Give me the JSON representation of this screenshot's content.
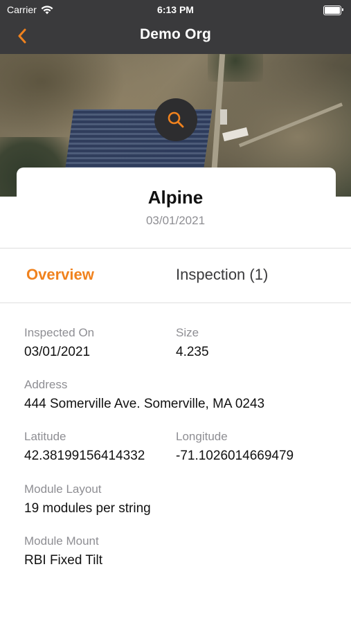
{
  "status_bar": {
    "carrier": "Carrier",
    "time": "6:13 PM"
  },
  "nav": {
    "title": "Demo Org",
    "accent": "#f0821e",
    "bar_color": "#3a3a3c"
  },
  "site": {
    "name": "Alpine",
    "date": "03/01/2021"
  },
  "tabs": [
    {
      "label": "Overview",
      "active": true
    },
    {
      "label": "Inspection (1)",
      "active": false
    }
  ],
  "details": {
    "inspected_on": {
      "label": "Inspected On",
      "value": "03/01/2021"
    },
    "size": {
      "label": "Size",
      "value": "4.235"
    },
    "address": {
      "label": "Address",
      "value": "444 Somerville Ave. Somerville, MA 0243"
    },
    "latitude": {
      "label": "Latitude",
      "value": "42.38199156414332"
    },
    "longitude": {
      "label": "Longitude",
      "value": "-71.1026014669479"
    },
    "module_layout": {
      "label": "Module Layout",
      "value": "19 modules per string"
    },
    "module_mount": {
      "label": "Module Mount",
      "value": "RBI Fixed Tilt"
    }
  },
  "icons": {
    "back": "chevron-left-icon",
    "search": "search-icon",
    "wifi": "wifi-icon",
    "battery": "battery-icon"
  }
}
